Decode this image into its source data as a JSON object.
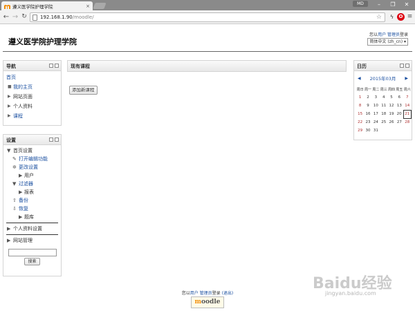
{
  "browser": {
    "tab_title": "遵义医学院护理学院",
    "tab_close": "×",
    "user_badge": "MD",
    "url_host": "192.168.1.90",
    "url_path": "/moodle/"
  },
  "site": {
    "title": "遵义医学院护理学院",
    "login_prefix": "您以",
    "login_user": "用户 管理员",
    "login_suffix": "登录",
    "language": "简体中文 (zh_cn)"
  },
  "navigation": {
    "title": "导航",
    "home": "首页",
    "items": [
      {
        "label": "我的主页",
        "bullet": "■",
        "link": true
      },
      {
        "label": "网站页面",
        "bullet": "▶",
        "link": false
      },
      {
        "label": "个人资料",
        "bullet": "▶",
        "link": false
      },
      {
        "label": "课程",
        "bullet": "▶",
        "link": true
      }
    ]
  },
  "settings": {
    "title": "设置",
    "front_page_settings": "首页设置",
    "items": [
      {
        "label": "打开编辑功能",
        "icon": "✎",
        "level": 2,
        "link": true
      },
      {
        "label": "更改设置",
        "icon": "✲",
        "level": 2,
        "link": true
      },
      {
        "label": "用户",
        "icon": "▶",
        "level": 3,
        "link": false
      },
      {
        "label": "过滤器",
        "icon": "▼",
        "level": 2,
        "link": true
      },
      {
        "label": "报表",
        "icon": "▶",
        "level": 3,
        "link": false
      },
      {
        "label": "备份",
        "icon": "⇧",
        "level": 2,
        "link": true
      },
      {
        "label": "恢复",
        "icon": "⇩",
        "level": 2,
        "link": true
      },
      {
        "label": "题库",
        "icon": "▶",
        "level": 3,
        "link": false
      }
    ],
    "profile_settings": "个人资料设置",
    "site_admin": "网站管理",
    "search_button": "搜索"
  },
  "main": {
    "title": "现有课程",
    "add_course_button": "添加新课程"
  },
  "calendar": {
    "title": "日历",
    "month": "2015年03月",
    "prev": "◀",
    "next": "▶",
    "weekdays": [
      "周日",
      "周一",
      "周二",
      "周三",
      "周四",
      "周五",
      "周六"
    ],
    "weeks": [
      [
        "1",
        "2",
        "3",
        "4",
        "5",
        "6",
        "7"
      ],
      [
        "8",
        "9",
        "10",
        "11",
        "12",
        "13",
        "14"
      ],
      [
        "15",
        "16",
        "17",
        "18",
        "19",
        "20",
        "21"
      ],
      [
        "22",
        "23",
        "24",
        "25",
        "26",
        "27",
        "28"
      ],
      [
        "29",
        "30",
        "31",
        "",
        "",
        "",
        ""
      ]
    ],
    "today": "21"
  },
  "footer": {
    "login_prefix": "您以",
    "login_user": "用户 管理员",
    "login_mid": "登录",
    "logout": "(退出)",
    "logo_m": "m",
    "logo_rest": "oodle"
  },
  "watermark": {
    "text": "Baidu经验",
    "sub": "jingyan.baidu.com"
  }
}
